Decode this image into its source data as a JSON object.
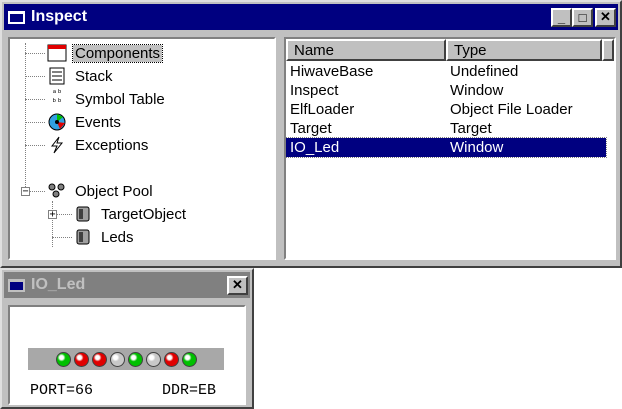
{
  "inspect_window": {
    "title": "Inspect",
    "buttons": {
      "minimize": "_",
      "maximize": "□",
      "close": "✕"
    },
    "tree": [
      {
        "label": "Components",
        "icon": "components-icon",
        "selected": true
      },
      {
        "label": "Stack",
        "icon": "stack-icon"
      },
      {
        "label": "Symbol Table",
        "icon": "symbol-table-icon"
      },
      {
        "label": "Events",
        "icon": "events-icon"
      },
      {
        "label": "Exceptions",
        "icon": "exceptions-icon"
      },
      {
        "label": "Object Pool",
        "icon": "object-pool-icon",
        "expander": "−"
      },
      {
        "label": "TargetObject",
        "icon": "object-icon",
        "expander": "+"
      },
      {
        "label": "Leds",
        "icon": "object-icon"
      }
    ],
    "list": {
      "columns": [
        "Name",
        "Type"
      ],
      "rows": [
        {
          "name": "HiwaveBase",
          "type": "Undefined"
        },
        {
          "name": "Inspect",
          "type": "Window"
        },
        {
          "name": "ElfLoader",
          "type": "Object File Loader"
        },
        {
          "name": "Target",
          "type": "Target"
        },
        {
          "name": "IO_Led",
          "type": "Window",
          "selected": true
        }
      ]
    }
  },
  "io_led_window": {
    "title": "IO_Led",
    "close": "✕",
    "leds": [
      {
        "state": "on",
        "color": "#00c000"
      },
      {
        "state": "on",
        "color": "#e00000"
      },
      {
        "state": "on",
        "color": "#e00000"
      },
      {
        "state": "off",
        "color": "#c8c8c8"
      },
      {
        "state": "on",
        "color": "#00c000"
      },
      {
        "state": "off",
        "color": "#c8c8c8"
      },
      {
        "state": "on",
        "color": "#e00000"
      },
      {
        "state": "on",
        "color": "#00c000"
      }
    ],
    "port_text": "PORT=66",
    "ddr_text": "DDR=EB"
  }
}
